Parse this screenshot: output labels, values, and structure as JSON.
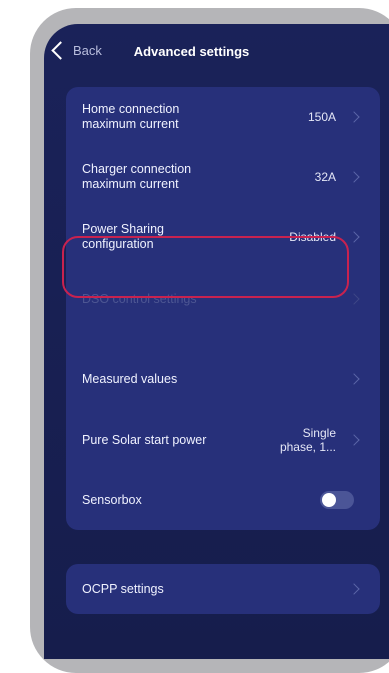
{
  "header": {
    "back_label": "Back",
    "title": "Advanced settings"
  },
  "settings": {
    "home_connection": {
      "label": "Home connection maximum current",
      "value": "150A"
    },
    "charger_connection": {
      "label": "Charger connection maximum current",
      "value": "32A"
    },
    "power_sharing": {
      "label": "Power Sharing configuration",
      "value": "Disabled"
    },
    "dso_control": {
      "label": "DSO control settings"
    },
    "measured_values": {
      "label": "Measured values"
    },
    "pure_solar": {
      "label": "Pure Solar start power",
      "value": "Single phase, 1..."
    },
    "sensorbox": {
      "label": "Sensorbox",
      "enabled": true
    }
  },
  "ocpp": {
    "label": "OCPP settings"
  },
  "colors": {
    "background": "#1a2259",
    "card": "#27307a",
    "highlight": "#c8224f"
  }
}
